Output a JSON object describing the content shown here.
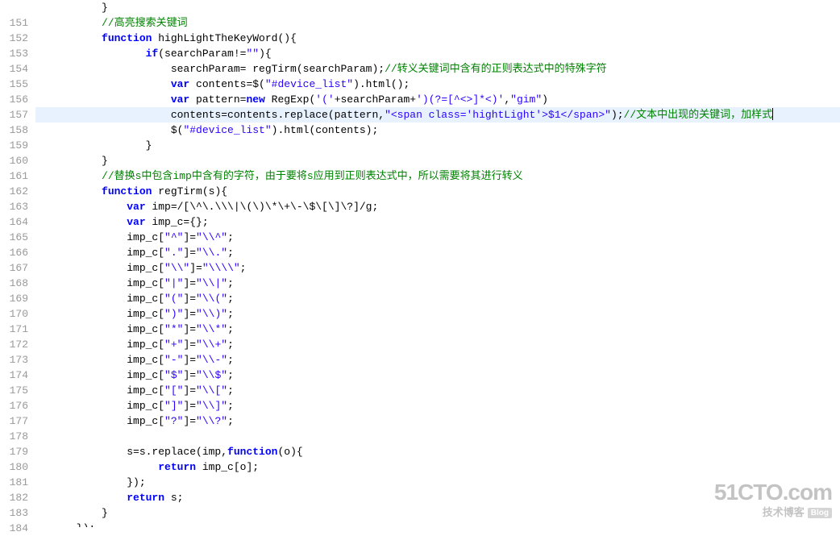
{
  "gutter": {
    "start": 151,
    "end": 184
  },
  "highlightedLineNumber": 157,
  "lines": {
    "150": [
      {
        "cls": "tk-plain",
        "text": "          }"
      }
    ],
    "151": [
      {
        "cls": "tk-plain",
        "text": "          "
      },
      {
        "cls": "tk-comment",
        "text": "//高亮搜索关键词"
      }
    ],
    "152": [
      {
        "cls": "tk-plain",
        "text": "          "
      },
      {
        "cls": "tk-keyword2",
        "text": "function"
      },
      {
        "cls": "tk-plain",
        "text": " highLightTheKeyWord(){"
      }
    ],
    "153": [
      {
        "cls": "tk-plain",
        "text": "                 "
      },
      {
        "cls": "tk-keyword2",
        "text": "if"
      },
      {
        "cls": "tk-plain",
        "text": "(searchParam!="
      },
      {
        "cls": "tk-string",
        "text": "\"\""
      },
      {
        "cls": "tk-plain",
        "text": "){"
      }
    ],
    "154": [
      {
        "cls": "tk-plain",
        "text": "                     searchParam= regTirm(searchParam);"
      },
      {
        "cls": "tk-comment",
        "text": "//转义关键词中含有的正则表达式中的特殊字符"
      }
    ],
    "155": [
      {
        "cls": "tk-plain",
        "text": "                     "
      },
      {
        "cls": "tk-keyword2",
        "text": "var"
      },
      {
        "cls": "tk-plain",
        "text": " contents=$("
      },
      {
        "cls": "tk-string",
        "text": "\"#device_list\""
      },
      {
        "cls": "tk-plain",
        "text": ").html();"
      }
    ],
    "156": [
      {
        "cls": "tk-plain",
        "text": "                     "
      },
      {
        "cls": "tk-keyword2",
        "text": "var"
      },
      {
        "cls": "tk-plain",
        "text": " pattern="
      },
      {
        "cls": "tk-keyword2",
        "text": "new"
      },
      {
        "cls": "tk-plain",
        "text": " RegExp("
      },
      {
        "cls": "tk-string",
        "text": "'('"
      },
      {
        "cls": "tk-plain",
        "text": "+searchParam+"
      },
      {
        "cls": "tk-string",
        "text": "')(?=[^<>]*<)'"
      },
      {
        "cls": "tk-plain",
        "text": ","
      },
      {
        "cls": "tk-string",
        "text": "\"gim\""
      },
      {
        "cls": "tk-plain",
        "text": ")"
      }
    ],
    "157": [
      {
        "cls": "tk-plain",
        "text": "                     contents=contents.replace(pattern,"
      },
      {
        "cls": "tk-string",
        "text": "\"<span class='hightLight'>$1</span>\""
      },
      {
        "cls": "tk-plain",
        "text": ");"
      },
      {
        "cls": "tk-comment",
        "text": "//文本中出现的关键词，加样式"
      }
    ],
    "158": [
      {
        "cls": "tk-plain",
        "text": "                     $("
      },
      {
        "cls": "tk-string",
        "text": "\"#device_list\""
      },
      {
        "cls": "tk-plain",
        "text": ").html(contents);"
      }
    ],
    "159": [
      {
        "cls": "tk-plain",
        "text": "                 }"
      }
    ],
    "160": [
      {
        "cls": "tk-plain",
        "text": "          }"
      }
    ],
    "161": [
      {
        "cls": "tk-plain",
        "text": "          "
      },
      {
        "cls": "tk-comment",
        "text": "//替换s中包含imp中含有的字符，由于要将s应用到正则表达式中，所以需要将其进行转义"
      }
    ],
    "162": [
      {
        "cls": "tk-plain",
        "text": "          "
      },
      {
        "cls": "tk-keyword2",
        "text": "function"
      },
      {
        "cls": "tk-plain",
        "text": " regTirm(s){"
      }
    ],
    "163": [
      {
        "cls": "tk-plain",
        "text": "              "
      },
      {
        "cls": "tk-keyword2",
        "text": "var"
      },
      {
        "cls": "tk-plain",
        "text": " imp=/[\\^\\.\\\\\\|\\(\\)\\*\\+\\-\\$\\[\\]\\?]/g;"
      }
    ],
    "164": [
      {
        "cls": "tk-plain",
        "text": "              "
      },
      {
        "cls": "tk-keyword2",
        "text": "var"
      },
      {
        "cls": "tk-plain",
        "text": " imp_c={};"
      }
    ],
    "165": [
      {
        "cls": "tk-plain",
        "text": "              imp_c["
      },
      {
        "cls": "tk-string",
        "text": "\"^\""
      },
      {
        "cls": "tk-plain",
        "text": "]="
      },
      {
        "cls": "tk-string",
        "text": "\"\\\\^\""
      },
      {
        "cls": "tk-plain",
        "text": ";"
      }
    ],
    "166": [
      {
        "cls": "tk-plain",
        "text": "              imp_c["
      },
      {
        "cls": "tk-string",
        "text": "\".\""
      },
      {
        "cls": "tk-plain",
        "text": "]="
      },
      {
        "cls": "tk-string",
        "text": "\"\\\\.\""
      },
      {
        "cls": "tk-plain",
        "text": ";"
      }
    ],
    "167": [
      {
        "cls": "tk-plain",
        "text": "              imp_c["
      },
      {
        "cls": "tk-string",
        "text": "\"\\\\\""
      },
      {
        "cls": "tk-plain",
        "text": "]="
      },
      {
        "cls": "tk-string",
        "text": "\"\\\\\\\\\""
      },
      {
        "cls": "tk-plain",
        "text": ";"
      }
    ],
    "168": [
      {
        "cls": "tk-plain",
        "text": "              imp_c["
      },
      {
        "cls": "tk-string",
        "text": "\"|\""
      },
      {
        "cls": "tk-plain",
        "text": "]="
      },
      {
        "cls": "tk-string",
        "text": "\"\\\\|\""
      },
      {
        "cls": "tk-plain",
        "text": ";"
      }
    ],
    "169": [
      {
        "cls": "tk-plain",
        "text": "              imp_c["
      },
      {
        "cls": "tk-string",
        "text": "\"(\""
      },
      {
        "cls": "tk-plain",
        "text": "]="
      },
      {
        "cls": "tk-string",
        "text": "\"\\\\(\""
      },
      {
        "cls": "tk-plain",
        "text": ";"
      }
    ],
    "170": [
      {
        "cls": "tk-plain",
        "text": "              imp_c["
      },
      {
        "cls": "tk-string",
        "text": "\")\""
      },
      {
        "cls": "tk-plain",
        "text": "]="
      },
      {
        "cls": "tk-string",
        "text": "\"\\\\)\""
      },
      {
        "cls": "tk-plain",
        "text": ";"
      }
    ],
    "171": [
      {
        "cls": "tk-plain",
        "text": "              imp_c["
      },
      {
        "cls": "tk-string",
        "text": "\"*\""
      },
      {
        "cls": "tk-plain",
        "text": "]="
      },
      {
        "cls": "tk-string",
        "text": "\"\\\\*\""
      },
      {
        "cls": "tk-plain",
        "text": ";"
      }
    ],
    "172": [
      {
        "cls": "tk-plain",
        "text": "              imp_c["
      },
      {
        "cls": "tk-string",
        "text": "\"+\""
      },
      {
        "cls": "tk-plain",
        "text": "]="
      },
      {
        "cls": "tk-string",
        "text": "\"\\\\+\""
      },
      {
        "cls": "tk-plain",
        "text": ";"
      }
    ],
    "173": [
      {
        "cls": "tk-plain",
        "text": "              imp_c["
      },
      {
        "cls": "tk-string",
        "text": "\"-\""
      },
      {
        "cls": "tk-plain",
        "text": "]="
      },
      {
        "cls": "tk-string",
        "text": "\"\\\\-\""
      },
      {
        "cls": "tk-plain",
        "text": ";"
      }
    ],
    "174": [
      {
        "cls": "tk-plain",
        "text": "              imp_c["
      },
      {
        "cls": "tk-string",
        "text": "\"$\""
      },
      {
        "cls": "tk-plain",
        "text": "]="
      },
      {
        "cls": "tk-string",
        "text": "\"\\\\$\""
      },
      {
        "cls": "tk-plain",
        "text": ";"
      }
    ],
    "175": [
      {
        "cls": "tk-plain",
        "text": "              imp_c["
      },
      {
        "cls": "tk-string",
        "text": "\"[\""
      },
      {
        "cls": "tk-plain",
        "text": "]="
      },
      {
        "cls": "tk-string",
        "text": "\"\\\\[\""
      },
      {
        "cls": "tk-plain",
        "text": ";"
      }
    ],
    "176": [
      {
        "cls": "tk-plain",
        "text": "              imp_c["
      },
      {
        "cls": "tk-string",
        "text": "\"]\""
      },
      {
        "cls": "tk-plain",
        "text": "]="
      },
      {
        "cls": "tk-string",
        "text": "\"\\\\]\""
      },
      {
        "cls": "tk-plain",
        "text": ";"
      }
    ],
    "177": [
      {
        "cls": "tk-plain",
        "text": "              imp_c["
      },
      {
        "cls": "tk-string",
        "text": "\"?\""
      },
      {
        "cls": "tk-plain",
        "text": "]="
      },
      {
        "cls": "tk-string",
        "text": "\"\\\\?\""
      },
      {
        "cls": "tk-plain",
        "text": ";"
      }
    ],
    "178": [
      {
        "cls": "tk-plain",
        "text": ""
      }
    ],
    "179": [
      {
        "cls": "tk-plain",
        "text": "              s=s.replace(imp,"
      },
      {
        "cls": "tk-keyword2",
        "text": "function"
      },
      {
        "cls": "tk-plain",
        "text": "(o){"
      }
    ],
    "180": [
      {
        "cls": "tk-plain",
        "text": "                   "
      },
      {
        "cls": "tk-keyword2",
        "text": "return"
      },
      {
        "cls": "tk-plain",
        "text": " imp_c[o];"
      }
    ],
    "181": [
      {
        "cls": "tk-plain",
        "text": "              });"
      }
    ],
    "182": [
      {
        "cls": "tk-plain",
        "text": "              "
      },
      {
        "cls": "tk-keyword2",
        "text": "return"
      },
      {
        "cls": "tk-plain",
        "text": " s;"
      }
    ],
    "183": [
      {
        "cls": "tk-plain",
        "text": "          }"
      }
    ],
    "184": [
      {
        "cls": "tk-plain",
        "text": "      });"
      }
    ]
  },
  "watermark": {
    "main": "51CTO.com",
    "sub": "技术博客",
    "blog": "Blog"
  }
}
